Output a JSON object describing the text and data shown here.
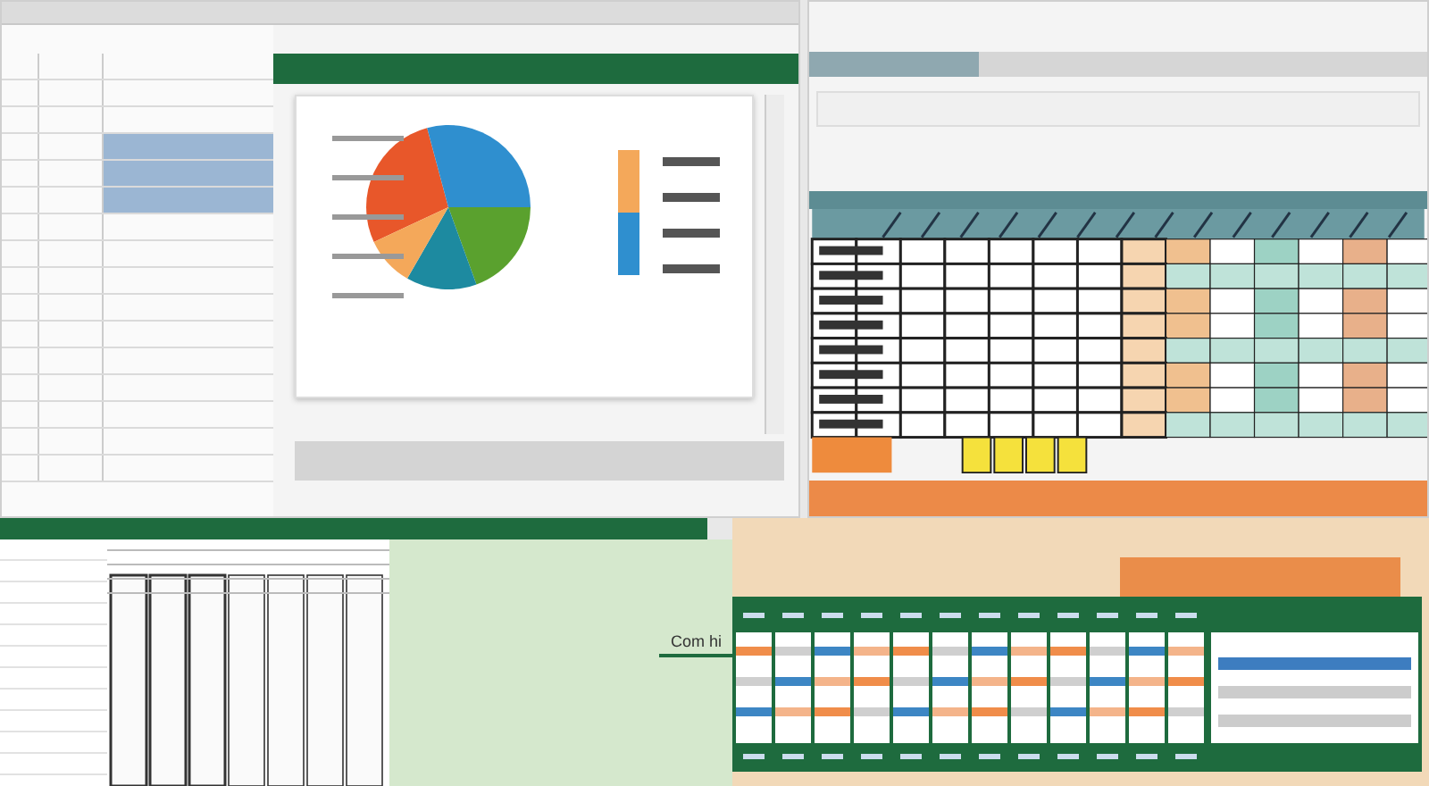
{
  "bottom_left_sheet": {
    "side_label": "Com hi"
  }
}
